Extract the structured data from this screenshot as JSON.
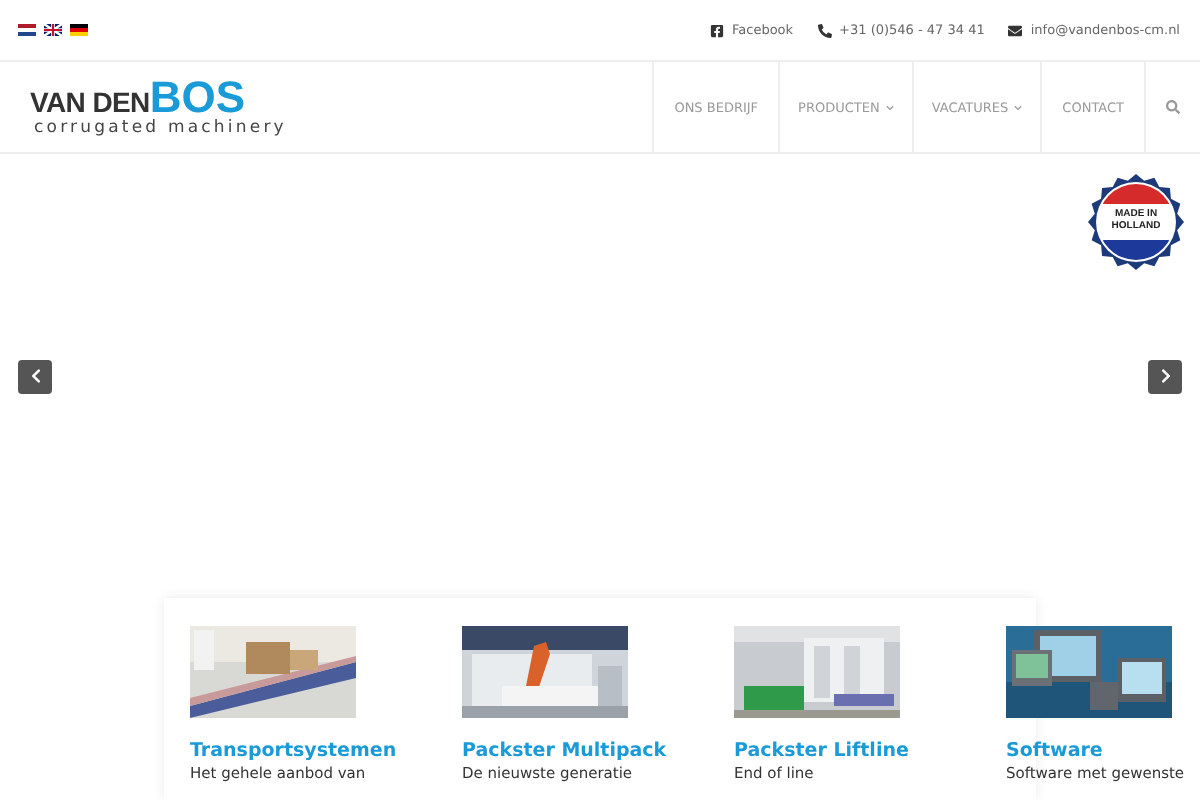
{
  "top_bar": {
    "languages": [
      {
        "kind": "nl"
      },
      {
        "kind": "en"
      },
      {
        "kind": "de"
      }
    ],
    "contacts": [
      {
        "kind": "facebook",
        "text": "Facebook"
      },
      {
        "kind": "phone",
        "text": "+31 (0)546 - 47 34 41"
      },
      {
        "kind": "mail",
        "text": "info@vandenbos-cm.nl"
      }
    ]
  },
  "header": {
    "logo": {
      "part_1": "VAN DEN",
      "part_2": "BOS",
      "tagline": "corrugated machinery"
    },
    "nav": [
      {
        "label": "ONS BEDRIJF",
        "dropdown": false
      },
      {
        "label": "PRODUCTEN",
        "dropdown": true
      },
      {
        "label": "VACATURES",
        "dropdown": true
      },
      {
        "label": "CONTACT",
        "dropdown": false
      }
    ]
  },
  "hero": {
    "badge": {
      "line_1": "MADE IN",
      "line_2": "HOLLAND"
    }
  },
  "cards": [
    {
      "kind": "conveyor",
      "title": "Transportsystemen",
      "text": "Het gehele aanbod van"
    },
    {
      "kind": "robot",
      "title": "Packster Multipack",
      "text": "De nieuwste generatie"
    },
    {
      "kind": "machine",
      "title": "Packster Liftline",
      "text": "End of line"
    },
    {
      "kind": "screens",
      "title": "Software",
      "text": "Software met gewenste"
    }
  ]
}
